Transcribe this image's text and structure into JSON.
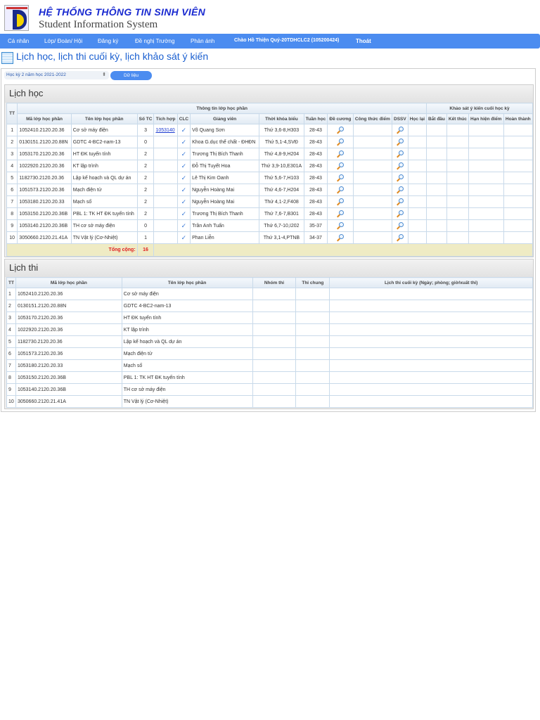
{
  "header": {
    "title_vn": "HỆ THỐNG THÔNG TIN SINH VIÊN",
    "title_en": "Student Information System"
  },
  "nav": {
    "items": [
      "Cá nhân",
      "Lớp/ Đoàn/ Hội",
      "Đăng ký",
      "Đề nghị Trường",
      "Phản ánh"
    ],
    "greeting": "Chào Hồ Thiện Quý-20TDHCLC2 (105200424)",
    "logout": "Thoát"
  },
  "page_title": "Lịch học, lịch thi cuối kỳ, lịch khảo sát ý kiến",
  "filter": {
    "semester": "Học kỳ 2 năm học 2021-2022",
    "button": "Dữ liệu"
  },
  "lich_hoc": {
    "title": "Lịch học",
    "group1": "Thông tin lớp học phần",
    "group2": "Khảo sát ý kiến cuối học kỳ",
    "headers": [
      "TT",
      "Mã lớp học phần",
      "Tên lớp học phần",
      "Số TC",
      "Tích hợp",
      "CLC",
      "Giảng viên",
      "Thời khóa biểu",
      "Tuần học",
      "Đề cương",
      "Công thức điểm",
      "DSSV",
      "Học lại",
      "Bắt đầu",
      "Kết thúc",
      "Hạn hiện điểm",
      "Hoàn thành"
    ],
    "rows": [
      [
        "1",
        "1052410.2120.20.36",
        "Cơ sở máy điện",
        "3",
        "1053140",
        "Võ Quang Sơn",
        "Thứ 3,6-8,H303",
        "28-43"
      ],
      [
        "2",
        "0130151.2120.20.88N",
        "GDTC 4-BC2-nam-13",
        "0",
        "",
        "Khoa G.dục thể chất - ĐHĐN",
        "Thứ 5,1-4,SVĐ",
        "28-43"
      ],
      [
        "3",
        "1053170.2120.20.36",
        "HT ĐK tuyến tính",
        "2",
        "",
        "Trương Thị Bích Thanh",
        "Thứ 4,8-9,H204",
        "28-43"
      ],
      [
        "4",
        "1022920.2120.20.36",
        "KT lập trình",
        "2",
        "",
        "Đỗ Thị Tuyết Hoa",
        "Thứ 3,9-10,E301A",
        "28-43"
      ],
      [
        "5",
        "1182730.2120.20.36",
        "Lập kế hoạch và QL dự án",
        "2",
        "",
        "Lê Thị Kim Oanh",
        "Thứ 5,6-7,H103",
        "28-43"
      ],
      [
        "6",
        "1051573.2120.20.36",
        "Mạch điện tử",
        "2",
        "",
        "Nguyễn Hoàng Mai",
        "Thứ 4,6-7,H204",
        "28-43"
      ],
      [
        "7",
        "1053180.2120.20.33",
        "Mạch số",
        "2",
        "",
        "Nguyễn Hoàng Mai",
        "Thứ 4,1-2,F408",
        "28-43"
      ],
      [
        "8",
        "1053150.2120.20.36B",
        "PBL 1: TK HT ĐK tuyến tính",
        "2",
        "",
        "Trương Thị Bích Thanh",
        "Thứ 7,6-7,B301",
        "28-43"
      ],
      [
        "9",
        "1053140.2120.20.36B",
        "TH cơ sở máy điện",
        "0",
        "",
        "Trần Anh Tuấn",
        "Thứ 6,7-10,I202",
        "35-37"
      ],
      [
        "10",
        "3050660.2120.21.41A",
        "TN Vật lý (Cơ-Nhiệt)",
        "1",
        "",
        "Phan Liễn",
        "Thứ 3,1-4,PTNB",
        "34-37"
      ]
    ],
    "total_label": "Tổng cộng:",
    "total": "16"
  },
  "lich_thi": {
    "title": "Lịch thi",
    "headers": [
      "TT",
      "Mã lớp học phần",
      "Tên lớp học phần",
      "Nhóm thi",
      "Thi chung",
      "Lịch thi cuối kỳ (Ngày; phòng; giờ/xuất thi)"
    ],
    "rows": [
      [
        "1",
        "1052410.2120.20.36",
        "Cơ sở máy điện"
      ],
      [
        "2",
        "0130151.2120.20.88N",
        "GDTC 4-BC2-nam-13"
      ],
      [
        "3",
        "1053170.2120.20.36",
        "HT ĐK tuyến tính"
      ],
      [
        "4",
        "1022920.2120.20.36",
        "KT lập trình"
      ],
      [
        "5",
        "1182730.2120.20.36",
        "Lập kế hoạch và QL dự án"
      ],
      [
        "6",
        "1051573.2120.20.36",
        "Mạch điện tử"
      ],
      [
        "7",
        "1053180.2120.20.33",
        "Mạch số"
      ],
      [
        "8",
        "1053150.2120.20.36B",
        "PBL 1: TK HT ĐK tuyến tính"
      ],
      [
        "9",
        "1053140.2120.20.36B",
        "TH cơ sở máy điện"
      ],
      [
        "10",
        "3050660.2120.21.41A",
        "TN Vật lý (Cơ-Nhiệt)"
      ]
    ]
  }
}
